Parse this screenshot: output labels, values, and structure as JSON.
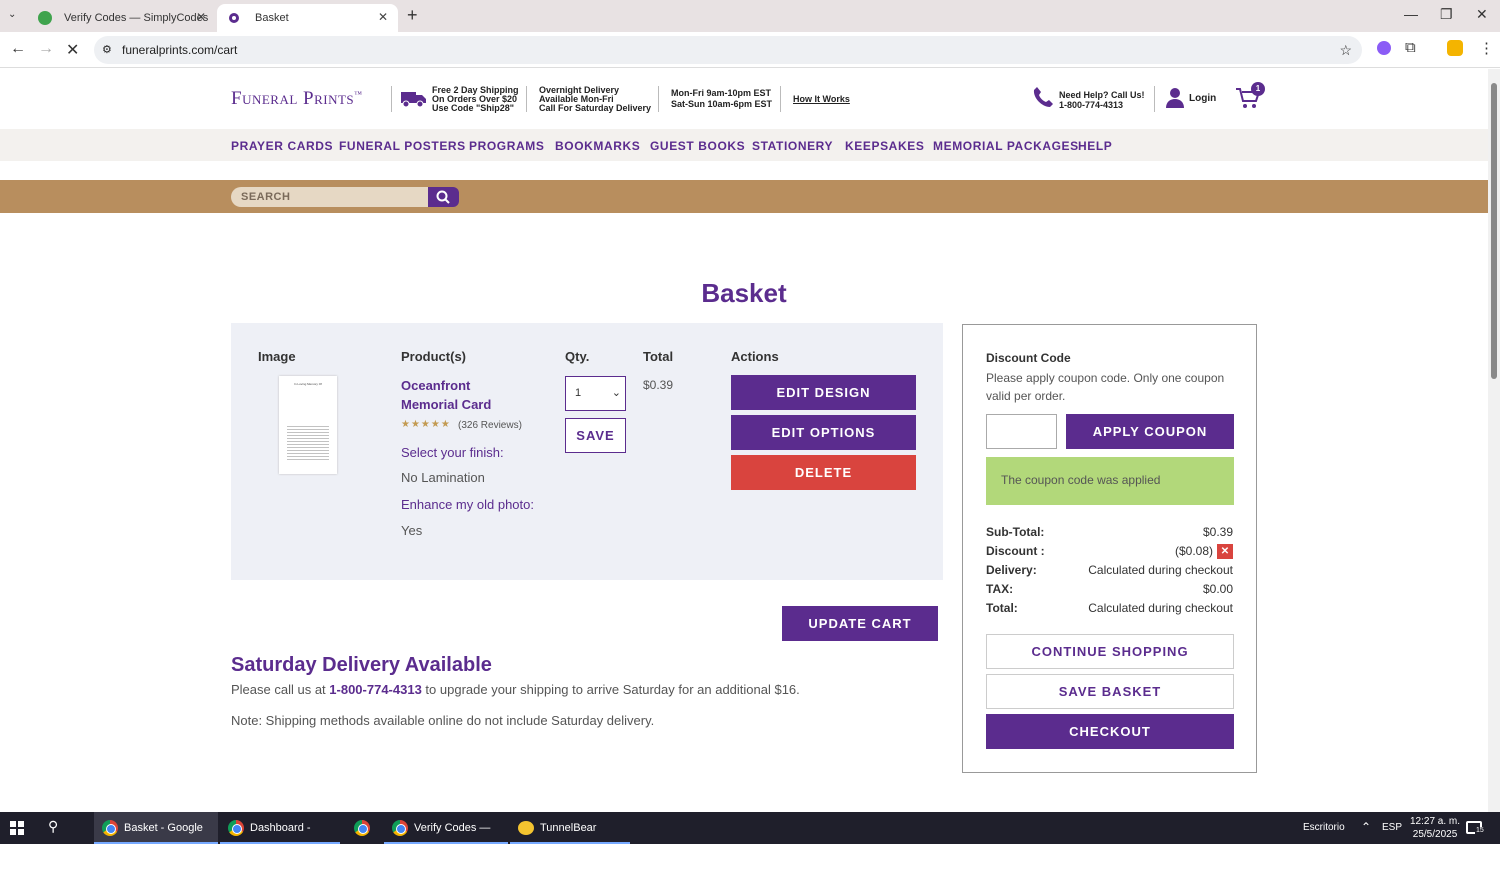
{
  "browser": {
    "tabs": [
      {
        "title": "Verify Codes — SimplyCodes",
        "active": false
      },
      {
        "title": "Basket",
        "active": true
      }
    ],
    "new_tab_icon": "plus-icon",
    "url": "funeralprints.com/cart"
  },
  "site": {
    "logo": "Funeral Prints",
    "logo_tm": "™",
    "shipping_promo": [
      "Free 2 Day Shipping",
      "On Orders Over $20",
      "Use Code \"Ship28\""
    ],
    "overnight": [
      "Overnight Delivery",
      "Available Mon-Fri",
      "Call For Saturday Delivery"
    ],
    "hours": [
      "Mon-Fri 9am-10pm EST",
      "Sat-Sun 10am-6pm EST"
    ],
    "how_it_works": "How It Works",
    "help_call": [
      "Need Help? Call Us!",
      "1-800-774-4313"
    ],
    "login": "Login",
    "cart_count": "1",
    "nav": [
      "PRAYER CARDS",
      "FUNERAL POSTERS",
      "PROGRAMS",
      "BOOKMARKS",
      "GUEST BOOKS",
      "STATIONERY",
      "KEEPSAKES",
      "MEMORIAL PACKAGES",
      "HELP"
    ],
    "search_placeholder": "SEARCH"
  },
  "basket": {
    "title": "Basket",
    "columns": {
      "image": "Image",
      "products": "Product(s)",
      "qty": "Qty.",
      "total": "Total",
      "actions": "Actions"
    },
    "item": {
      "name": "Oceanfront Memorial Card",
      "rating": 5,
      "reviews": "(326 Reviews)",
      "finish_label": "Select your finish:",
      "finish_value": "No Lamination",
      "photo_label": "Enhance my old photo:",
      "photo_value": "Yes",
      "qty": "1",
      "total": "$0.39",
      "thumb_title": "In Loving Memory Of"
    },
    "buttons": {
      "save": "SAVE",
      "edit_design": "EDIT DESIGN",
      "edit_options": "EDIT OPTIONS",
      "delete": "DELETE",
      "update_cart": "UPDATE CART"
    },
    "saturday": {
      "heading": "Saturday Delivery Available",
      "text_before": "Please call us at ",
      "phone": "1-800-774-4313",
      "text_after": " to upgrade your shipping to arrive Saturday for an additional $16.",
      "note": "Note: Shipping methods available online do not include Saturday delivery."
    }
  },
  "summary": {
    "discount_heading": "Discount Code",
    "discount_help": "Please apply coupon code. Only one coupon valid per order.",
    "apply_button": "APPLY COUPON",
    "applied_msg": "The coupon code was applied",
    "rows": [
      {
        "label": "Sub-Total:",
        "value": "$0.39"
      },
      {
        "label": "Discount :",
        "value": "($0.08)"
      },
      {
        "label": "Delivery:",
        "value": "Calculated during checkout"
      },
      {
        "label": "TAX:",
        "value": "$0.00"
      },
      {
        "label": "Total:",
        "value": "Calculated during checkout"
      }
    ],
    "continue_shopping": "CONTINUE SHOPPING",
    "save_basket": "SAVE BASKET",
    "checkout": "CHECKOUT"
  },
  "taskbar": {
    "items": [
      "Basket - Google Ch...",
      "Dashboard - Googl...",
      "",
      "Verify Codes — Sim...",
      "TunnelBear"
    ],
    "desktop": "Escritorio",
    "lang": "ESP",
    "time": "12:27 a. m.",
    "date": "25/5/2025",
    "notif_count": "15"
  },
  "colors": {
    "brand_purple": "#5b2c8e",
    "delete_red": "#d9443e",
    "search_band": "#b88e5e",
    "success_green": "#b2d87a"
  }
}
